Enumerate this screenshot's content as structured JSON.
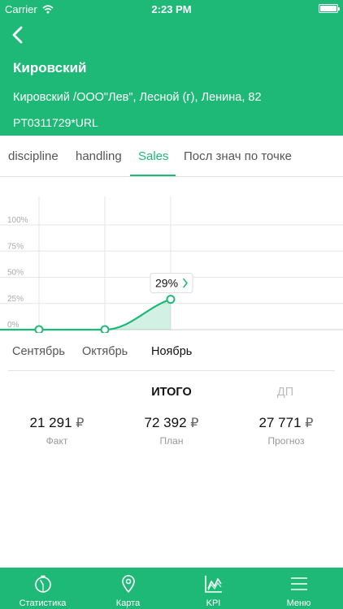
{
  "status_bar": {
    "carrier": "Carrier",
    "time": "2:23 PM",
    "wifi_icon": "wifi-icon",
    "battery_icon": "battery-icon"
  },
  "header": {
    "back_icon": "chevron-left-icon",
    "title": "Кировский",
    "address": "Кировский /ООО\"Лев\", Лесной (г), Ленина, 82",
    "code": "PT0311729*URL"
  },
  "tabs": [
    {
      "label": "discipline",
      "active": false
    },
    {
      "label": "handling",
      "active": false
    },
    {
      "label": "Sales",
      "active": true
    },
    {
      "label": "Посл знач по точке",
      "active": false
    }
  ],
  "chart_data": {
    "type": "area",
    "categories": [
      "Сентябрь",
      "Октябрь",
      "Ноябрь"
    ],
    "values": [
      0,
      0,
      29
    ],
    "yticks": [
      "100%",
      "75%",
      "50%",
      "25%",
      "0%"
    ],
    "ylim": [
      0,
      100
    ],
    "selected_category": "Ноябрь",
    "callout": "29%",
    "line_color": "#1fb977"
  },
  "months": [
    {
      "label": "Сентябрь",
      "active": false
    },
    {
      "label": "Октябрь",
      "active": false
    },
    {
      "label": "Ноябрь",
      "active": true
    }
  ],
  "summary": {
    "heading_total": "ИТОГО",
    "heading_dp": "ДП",
    "currency": "₽",
    "items": [
      {
        "value": "21 291",
        "label": "Факт"
      },
      {
        "value": "72 392",
        "label": "План"
      },
      {
        "value": "27 771",
        "label": "Прогноз"
      }
    ]
  },
  "tabbar": [
    {
      "label": "Статистика",
      "icon": "stopwatch-icon",
      "active": false
    },
    {
      "label": "Карта",
      "icon": "map-pin-icon",
      "active": false
    },
    {
      "label": "KPI",
      "icon": "line-chart-icon",
      "active": true
    },
    {
      "label": "Меню",
      "icon": "hamburger-menu-icon",
      "active": false
    }
  ]
}
